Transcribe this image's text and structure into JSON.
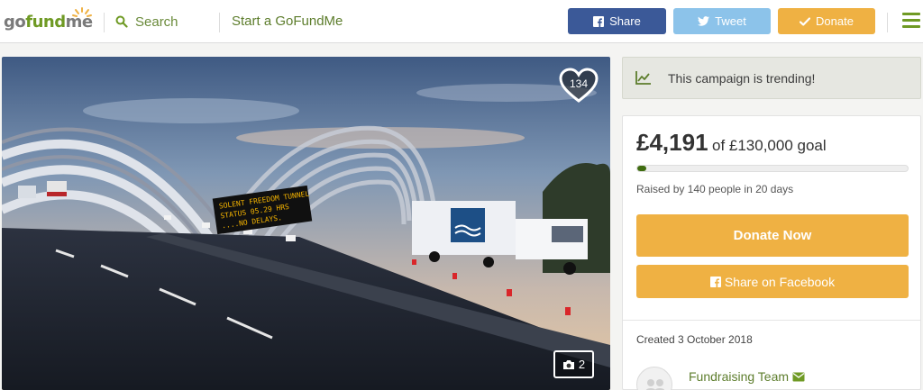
{
  "header": {
    "logo_go": "go",
    "logo_fund": "fund",
    "logo_me": "me",
    "search_label": "Search",
    "start_label": "Start a GoFundMe",
    "share_label": "Share",
    "tweet_label": "Tweet",
    "donate_label": "Donate",
    "colors": {
      "brand_green": "#6f9a24",
      "facebook": "#3b5998",
      "twitter": "#8cc3ea",
      "donate": "#efb143"
    }
  },
  "hero": {
    "sign_line1": "SOLENT FREEDOM TUNNEL",
    "sign_line2": "STATUS 05.29 HRS",
    "sign_line3": "....NO DELAYS.",
    "heart_count": "134",
    "photo_count": "2"
  },
  "sidebar": {
    "trending_text": "This campaign is trending!",
    "raised_amount": "£4,191",
    "goal_text": "of £130,000 goal",
    "progress_fraction": 0.032,
    "raised_by_text": "Raised by 140 people in 20 days",
    "donate_now_label": "Donate Now",
    "share_facebook_label": "Share on Facebook",
    "created_text": "Created 3 October 2018",
    "team_label": "Fundraising Team"
  }
}
